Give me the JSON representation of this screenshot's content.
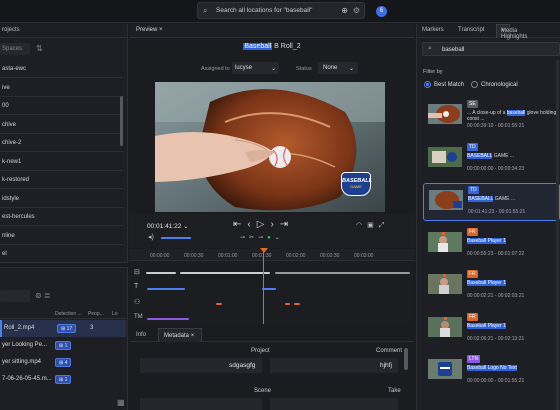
{
  "topbar": {
    "search_placeholder": "Search all locations for \"baseball\"",
    "notif_count": "6"
  },
  "left": {
    "tab_label": "rojects",
    "filter_placeholder": "Spaces",
    "projects": [
      "asta-ewc",
      "ive",
      "00",
      "chive",
      "chive-2",
      "k-new1",
      "k-restored",
      "idstyle",
      "est-hercules",
      "nline",
      "el"
    ],
    "col_detection": "Detection ...",
    "col_people": "Peop...",
    "col_lo": "Lo",
    "files": [
      {
        "name": "Roll_2.mp4",
        "tag": "17",
        "count": "3"
      },
      {
        "name": "yer Looking Pe...",
        "tag": "1",
        "count": ""
      },
      {
        "name": "yer sitting.mp4",
        "tag": "4",
        "count": ""
      },
      {
        "name": "7-06-26-05-45.m...",
        "tag": "1",
        "count": ""
      }
    ]
  },
  "center": {
    "tab_label": "Preview",
    "clip_title_hl": "Baseball",
    "clip_title_rest": " B Roll_2",
    "assigned_label": "Assigned to",
    "assigned_value": "lucyse",
    "status_label": "Status",
    "status_value": "None",
    "timecode": "00:01:41:22",
    "ruler_marks": [
      "00:00:00",
      "00:00:30",
      "00:01:00",
      "00:01:30",
      "00:02:00",
      "00:02:30",
      "00:03:00"
    ],
    "logo_text": "BASEBALL",
    "logo_sub": "GAME",
    "tabs": {
      "info": "Info",
      "metadata": "Metadata"
    },
    "meta": {
      "project_label": "Project",
      "project_value": "sdgasgfg",
      "comment_label": "Comment",
      "comment_value": "hjhfj",
      "scene_label": "Scene",
      "take_label": "Take"
    }
  },
  "right": {
    "tabs": [
      "Markers",
      "Transcript",
      "Media Highlights"
    ],
    "search_value": "baseball",
    "filter_label": "Filter by",
    "opt_best": "Best Match",
    "opt_chrono": "Chronological",
    "highlights": [
      {
        "badge": "SE",
        "badge_color": "#5a5d66",
        "desc_pre": "... A close-up of a ",
        "desc_hl": "baseball",
        "desc_post": " glove holding",
        "desc2": "const ...",
        "time": "00:00:39:10 - 00:01:55:21"
      },
      {
        "badge": "TD",
        "badge_color": "#3a66d8",
        "desc_pre": "",
        "desc_hl": "BASEBALL",
        "desc_post": " GAME ...",
        "desc2": "",
        "time": "00:00:00:00 - 00:00:34:23"
      },
      {
        "badge": "TD",
        "badge_color": "#3a66d8",
        "desc_pre": "",
        "desc_hl": "BASEBALL",
        "desc_post": " GAME ...",
        "desc2": "",
        "time": "00:01:41:23 - 00:01:55:21"
      },
      {
        "badge": "FR",
        "badge_color": "#d9662a",
        "desc_pre": "",
        "desc_hl": "Baseball Player 1",
        "desc_post": "",
        "desc2": "",
        "time": "00:00:55:23 - 00:01:07:22"
      },
      {
        "badge": "FR",
        "badge_color": "#d9662a",
        "desc_pre": "",
        "desc_hl": "Baseball Player 1",
        "desc_post": "",
        "desc2": "",
        "time": "00:00:02:21 - 00:02:03:21"
      },
      {
        "badge": "FR",
        "badge_color": "#d9662a",
        "desc_pre": "",
        "desc_hl": "Baseball Player 1",
        "desc_post": "",
        "desc2": "",
        "time": "00:02:06:21 - 00:02:13:21"
      },
      {
        "badge": "LTN",
        "badge_color": "#8a5be0",
        "desc_pre": "",
        "desc_hl": "Baseball Logo No Text",
        "desc_post": "",
        "desc2": "",
        "time": "00:00:00:00 - 00:01:55:21"
      }
    ]
  }
}
